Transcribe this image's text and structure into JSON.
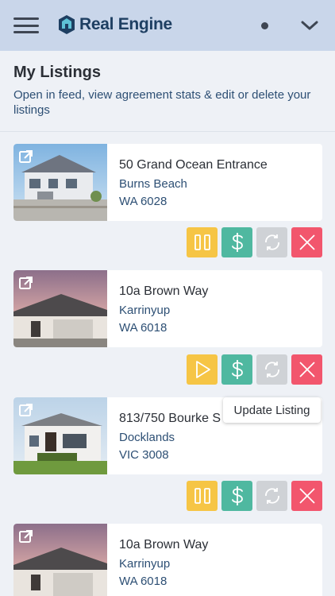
{
  "app": {
    "brand_name": "Real Engine",
    "brand_color": "#1e3f62"
  },
  "header": {
    "title": "My Listings",
    "subtitle": "Open in feed, view agreement stats & edit or delete your listings"
  },
  "colors": {
    "pause_play": "#f6c545",
    "dollar": "#4fb8a0",
    "refresh": "#cfd2d6",
    "delete": "#f2566d",
    "accent_text": "#2d4f74"
  },
  "listings": [
    {
      "address": "50 Grand Ocean Entrance",
      "suburb": "Burns Beach",
      "state_postcode": "WA 6028",
      "status_action": "pause"
    },
    {
      "address": "10a Brown Way",
      "suburb": "Karrinyup",
      "state_postcode": "WA 6018",
      "status_action": "play"
    },
    {
      "address": "813/750 Bourke S",
      "suburb": "Docklands",
      "state_postcode": "VIC 3008",
      "status_action": "pause"
    },
    {
      "address": "10a Brown Way",
      "suburb": "Karrinyup",
      "state_postcode": "WA 6018",
      "status_action": "none"
    }
  ],
  "tooltip": {
    "text": "Update Listing"
  }
}
